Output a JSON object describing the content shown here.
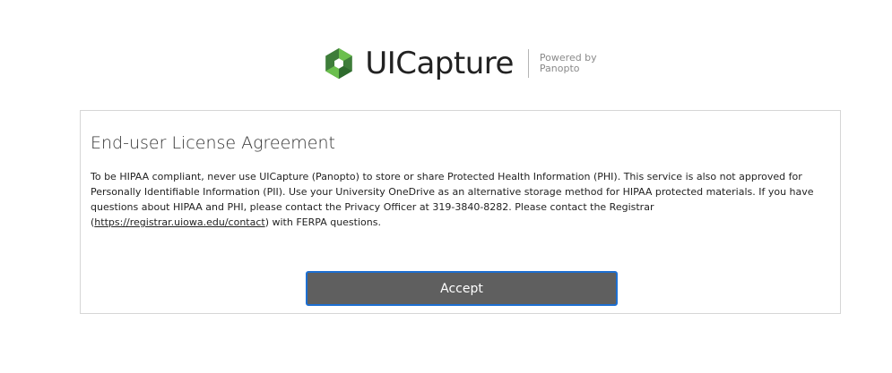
{
  "brand": {
    "logo_icon": "panopto-hexagon-icon",
    "name": "UICapture",
    "powered_line1": "Powered by",
    "powered_line2": "Panopto",
    "colors": {
      "green_dark": "#3e7d3a",
      "green_light": "#6bbf4e",
      "green_mid": "#2f6b2e"
    }
  },
  "agreement": {
    "title": "End-user License Agreement",
    "body_before_link": "To be HIPAA compliant, never use UICapture (Panopto) to store or share Protected Health Information (PHI). This service is also not approved for Personally Identifiable Information (PII). Use your University OneDrive as an alternative storage method for HIPAA protected materials. If you have questions about HIPAA and PHI, please contact the Privacy Officer at 319-3840-8282. Please contact the Registrar (",
    "link_text": "https://registrar.uiowa.edu/contact",
    "body_after_link": ") with FERPA questions.",
    "accept_label": "Accept"
  },
  "colors": {
    "button_bg": "#5f5f5f",
    "button_border": "#1d6fd1",
    "card_border": "#d6d6d6"
  }
}
